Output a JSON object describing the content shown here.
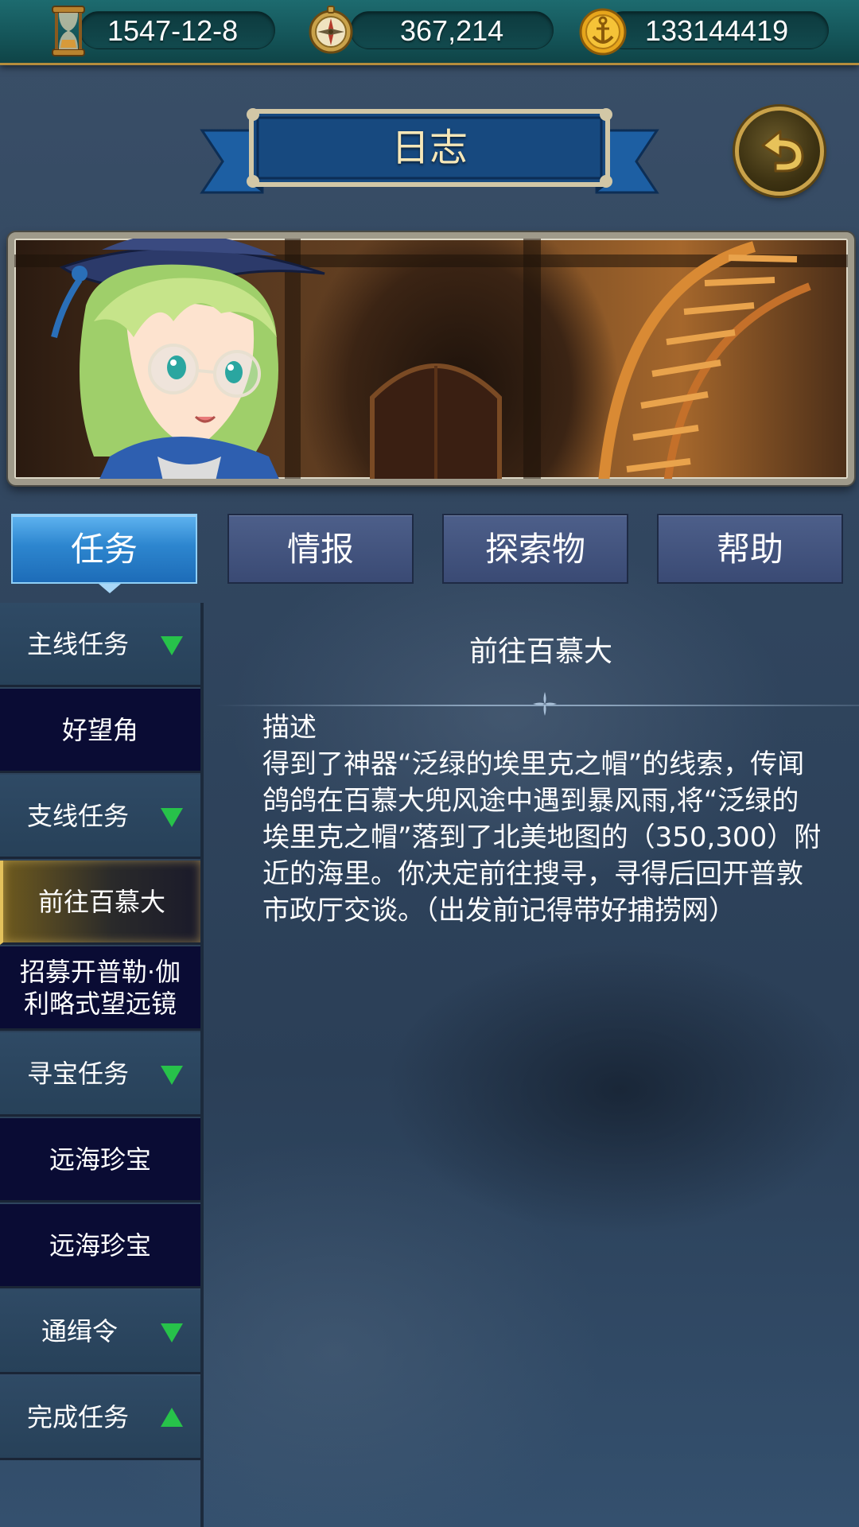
{
  "resources": {
    "date": {
      "value": "1547-12-8",
      "icon": "hourglass-icon"
    },
    "compass": {
      "value": "367,214",
      "icon": "compass-icon"
    },
    "gold": {
      "value": "133144419",
      "icon": "anchor-coin-icon"
    }
  },
  "header": {
    "title": "日志",
    "back_icon": "back-arrow-icon"
  },
  "tabs": [
    {
      "label": "任务",
      "active": true
    },
    {
      "label": "情报",
      "active": false
    },
    {
      "label": "探索物",
      "active": false
    },
    {
      "label": "帮助",
      "active": false
    }
  ],
  "sidebar": {
    "items": [
      {
        "label": "主线任务",
        "type": "category",
        "arrow": "down"
      },
      {
        "label": "好望角",
        "type": "quest"
      },
      {
        "label": "支线任务",
        "type": "category",
        "arrow": "down"
      },
      {
        "label": "前往百慕大",
        "type": "quest",
        "selected": true
      },
      {
        "label": "招募开普勒·伽利略式望远镜",
        "type": "quest"
      },
      {
        "label": "寻宝任务",
        "type": "category",
        "arrow": "down"
      },
      {
        "label": "远海珍宝",
        "type": "quest"
      },
      {
        "label": "远海珍宝",
        "type": "quest"
      },
      {
        "label": "通缉令",
        "type": "category",
        "arrow": "down"
      },
      {
        "label": "完成任务",
        "type": "category",
        "arrow": "up"
      }
    ]
  },
  "content": {
    "title": "前往百慕大",
    "desc_label": "描述",
    "desc_text": "得到了神器“泛绿的埃里克之帽”的线索，传闻鸽鸽在百慕大兜风途中遇到暴风雨,将“泛绿的埃里克之帽”落到了北美地图的（350,300）附近的海里。你决定前往搜寻，寻得后回开普敦市政厅交谈。（出发前记得带好捕捞网）"
  },
  "colors": {
    "accent_tab": "#2d86cf",
    "tab_inactive": "#3a4a74",
    "arrow_green": "#27c24a",
    "banner_blue": "#17497f",
    "gold_trim": "#c9a24a"
  }
}
